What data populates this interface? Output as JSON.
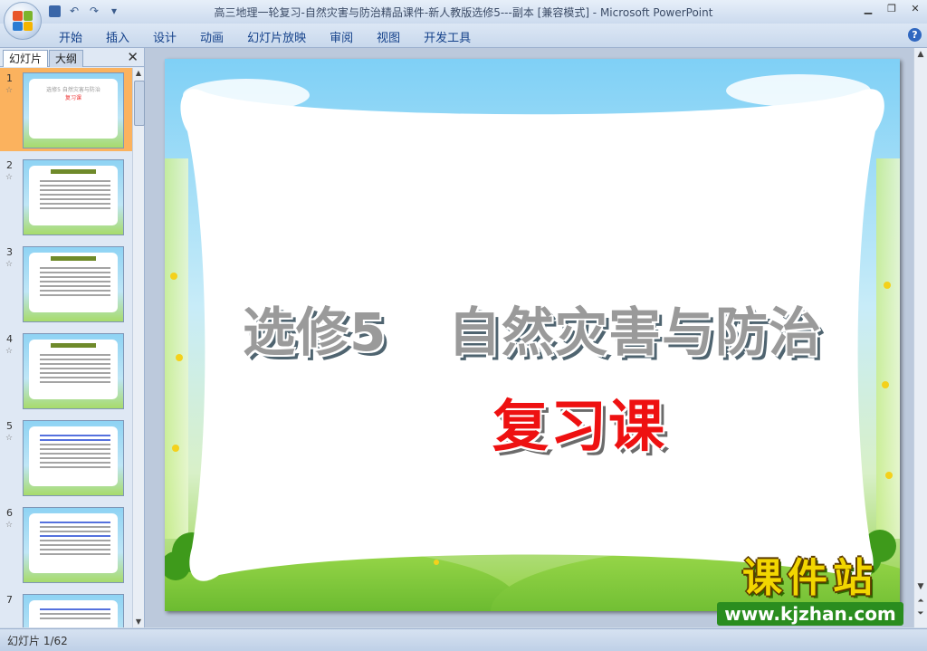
{
  "window": {
    "title": "高三地理一轮复习-自然灾害与防治精品课件-新人教版选修5---副本 [兼容模式] - Microsoft PowerPoint"
  },
  "ribbon": {
    "tabs": [
      "开始",
      "插入",
      "设计",
      "动画",
      "幻灯片放映",
      "审阅",
      "视图",
      "开发工具"
    ]
  },
  "panel": {
    "tab_slides": "幻灯片",
    "tab_outline": "大纲",
    "thumbnails": [
      {
        "num": "1",
        "star": "☆"
      },
      {
        "num": "2",
        "star": "☆"
      },
      {
        "num": "3",
        "star": "☆"
      },
      {
        "num": "4",
        "star": "☆"
      },
      {
        "num": "5",
        "star": "☆"
      },
      {
        "num": "6",
        "star": "☆"
      },
      {
        "num": "7",
        "star": ""
      }
    ]
  },
  "slide": {
    "title_part1": "选修5",
    "title_part2": "自然灾害与防治",
    "subtitle": "复习课",
    "colors": {
      "title": "#9a9a9a",
      "subtitle": "#ee1111"
    }
  },
  "status": {
    "slide_counter": "幻灯片 1/62"
  },
  "watermark": {
    "logo": "课件站",
    "url": "www.kjzhan.com"
  },
  "icons": [
    "office-logo-icon",
    "save-icon",
    "undo-icon",
    "redo-icon",
    "minimize-icon",
    "restore-icon",
    "close-icon",
    "help-icon"
  ]
}
